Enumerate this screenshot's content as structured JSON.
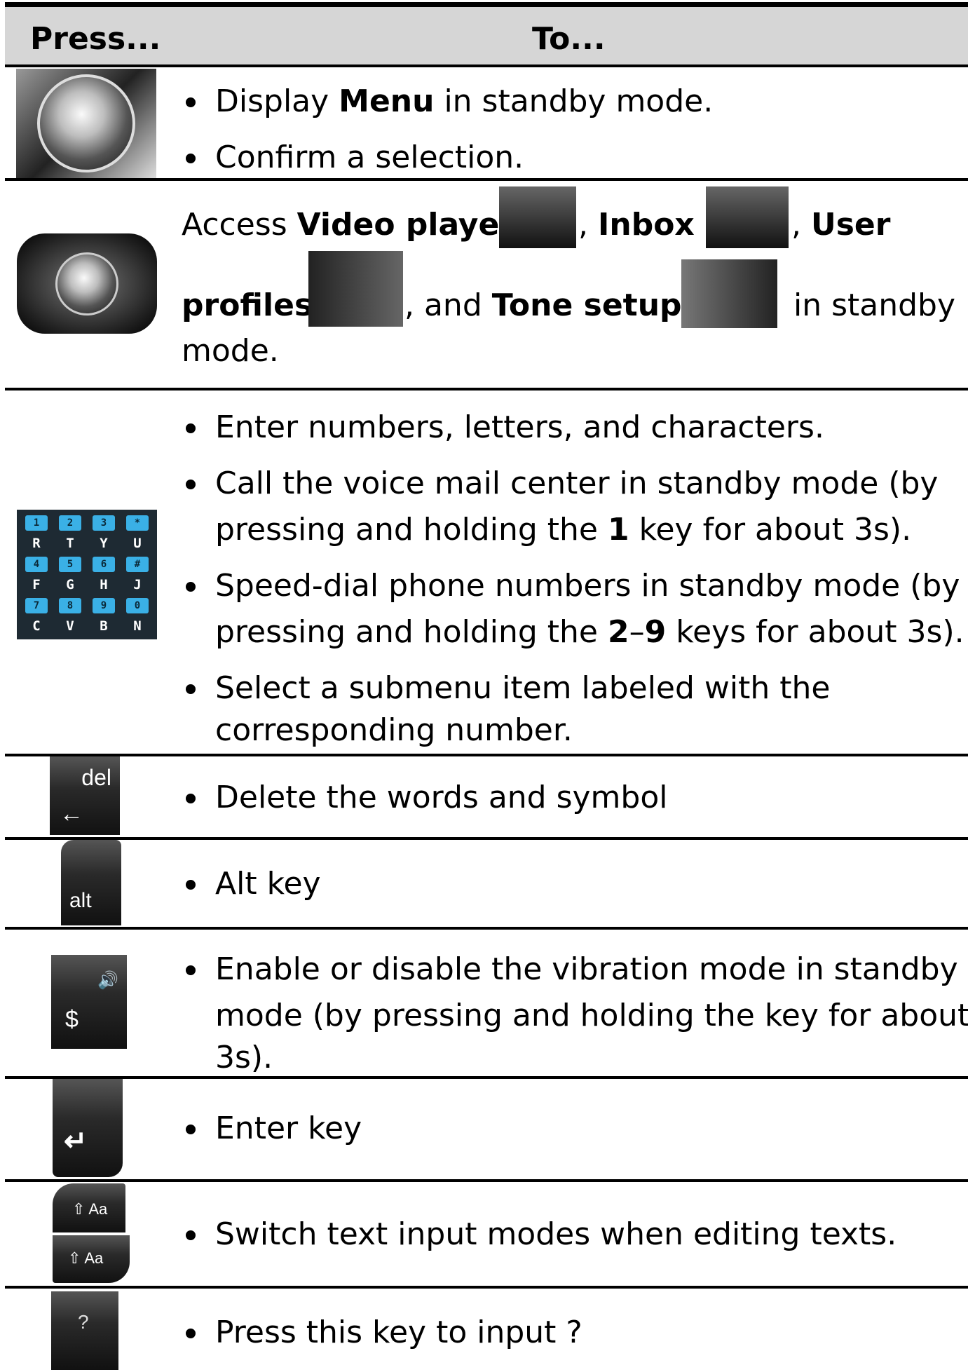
{
  "header": {
    "press": "Press...",
    "to": "To..."
  },
  "rows": [
    {
      "bullets": [
        {
          "pre": "Display ",
          "bold": "Menu",
          "post": " in standby mode."
        },
        {
          "text": "Confirm a selection."
        }
      ]
    },
    {
      "pre": "Access ",
      "video": "Video player",
      "sep1": ",",
      "inbox": "Inbox",
      "sep2": ",",
      "user": "User",
      "profiles": "profiles",
      "mid": ", and ",
      "tone": "Tone setup",
      "post": "in standby",
      "post2": "mode."
    },
    {
      "bullets": [
        {
          "text": "Enter numbers, letters, and characters."
        },
        {
          "l1": "Call the voice mail center in standby mode (by",
          "l2pre": "pressing and holding the ",
          "l2bold": "1",
          "l2post": " key for about 3s)."
        },
        {
          "l1": "Speed-dial phone numbers in standby mode (by",
          "l2pre": "pressing and holding the ",
          "l2b1": "2",
          "l2dash": "–",
          "l2b2": "9",
          "l2post": " keys for about 3s)."
        },
        {
          "l1": "Select a submenu item labeled with the",
          "l2": "corresponding number."
        }
      ],
      "keypad": [
        [
          "1",
          "2",
          "3",
          "*"
        ],
        [
          "R",
          "T",
          "Y",
          "U"
        ],
        [
          "4",
          "5",
          "6",
          "#"
        ],
        [
          "F",
          "G",
          "H",
          "J"
        ],
        [
          "7",
          "8",
          "9",
          "0"
        ],
        [
          "C",
          "V",
          "B",
          "N"
        ]
      ]
    },
    {
      "text": "Delete the words and symbol",
      "key": "del",
      "arrow": "←"
    },
    {
      "text": "Alt key",
      "key": "alt"
    },
    {
      "l1": "Enable or disable the vibration mode in standby",
      "l2": "mode (by pressing and holding the key for about",
      "l3": "3s).",
      "key": "$",
      "speaker": "🔊"
    },
    {
      "text": "Enter key",
      "arrow": "↵"
    },
    {
      "text": "Switch text input modes when editing texts.",
      "key": "⇧ Aa"
    },
    {
      "text": "Press this key to input ?",
      "key": "?"
    }
  ]
}
